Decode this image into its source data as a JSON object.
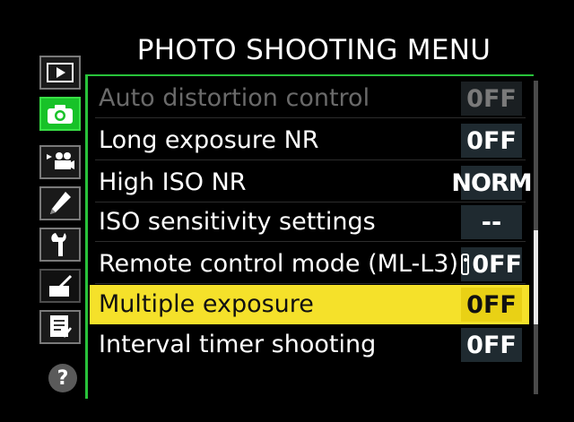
{
  "menu": {
    "title": "PHOTO SHOOTING MENU"
  },
  "tabs": [
    {
      "name": "playback-menu-tab",
      "icon": "playback-icon",
      "active": false
    },
    {
      "name": "photo-shooting-menu-tab",
      "icon": "camera-icon",
      "active": true
    },
    {
      "name": "movie-shooting-menu-tab",
      "icon": "movie-camera-icon",
      "active": false
    },
    {
      "name": "custom-settings-menu-tab",
      "icon": "pencil-icon",
      "active": false
    },
    {
      "name": "setup-menu-tab",
      "icon": "wrench-icon",
      "active": false
    },
    {
      "name": "retouch-menu-tab",
      "icon": "retouch-brush-icon",
      "active": false
    },
    {
      "name": "my-menu-tab",
      "icon": "my-menu-list-icon",
      "active": false
    }
  ],
  "help": {
    "label": "?"
  },
  "items": [
    {
      "label": "Auto distortion control",
      "value": "0FF",
      "state": "disabled"
    },
    {
      "label": "Long exposure NR",
      "value": "0FF",
      "state": "normal"
    },
    {
      "label": "High ISO NR",
      "value": "NORM",
      "state": "normal"
    },
    {
      "label": "ISO sensitivity settings",
      "value": "--",
      "state": "normal"
    },
    {
      "label": "Remote control mode (ML-L3)",
      "value": "0FF",
      "state": "normal",
      "value_icon": "remote-control-icon"
    },
    {
      "label": "Multiple exposure",
      "value": "0FF",
      "state": "selected"
    },
    {
      "label": "Interval timer shooting",
      "value": "0FF",
      "state": "normal"
    }
  ],
  "scrollbar": {
    "position_fraction": 0.68,
    "visible_fraction": 0.3
  },
  "colors": {
    "accent_green": "#17c228",
    "highlight_yellow": "#f5e12a",
    "value_box": "#1f2a30"
  }
}
